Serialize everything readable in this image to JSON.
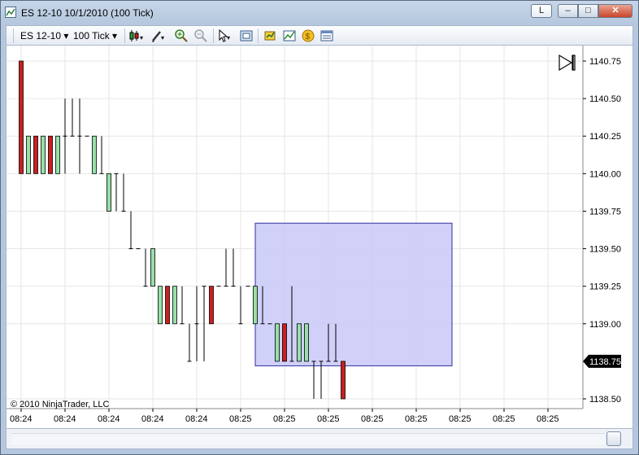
{
  "window": {
    "title": "ES 12-10  10/1/2010 (100 Tick)",
    "buttons": {
      "layout_label": "L",
      "minimize": "–",
      "maximize": "□",
      "close": "✕"
    }
  },
  "toolbar": {
    "instrument": "ES 12-10",
    "interval": "100 Tick",
    "icons": [
      "chart-style-icon",
      "drawing-tool-icon",
      "zoom-in-icon",
      "zoom-out-icon",
      "pointer-icon",
      "data-box-icon",
      "strategies-icon",
      "indicators-icon",
      "money-icon",
      "properties-icon"
    ]
  },
  "chart_data": {
    "type": "candlestick",
    "y_ticks": [
      "1140.75",
      "1140.50",
      "1140.25",
      "1140.00",
      "1139.75",
      "1139.50",
      "1139.25",
      "1139.00",
      "1138.50"
    ],
    "y_tick_values": [
      1140.75,
      1140.5,
      1140.25,
      1140.0,
      1139.75,
      1139.5,
      1139.25,
      1139.0,
      1138.5
    ],
    "current_price": "1138.75",
    "x_ticks": [
      "08:24",
      "08:24",
      "08:24",
      "08:24",
      "08:24",
      "08:25",
      "08:25",
      "08:25",
      "08:25",
      "08:25",
      "08:25",
      "08:25",
      "08:25"
    ],
    "bars": [
      {
        "o": 1140.0,
        "h": 1140.75,
        "l": 1140.0,
        "c": 1140.75,
        "dir": "up"
      },
      {
        "o": 1140.25,
        "h": 1140.25,
        "l": 1140.0,
        "c": 1140.0,
        "dir": "down"
      },
      {
        "o": 1140.0,
        "h": 1140.25,
        "l": 1140.0,
        "c": 1140.25,
        "dir": "up"
      },
      {
        "o": 1140.25,
        "h": 1140.25,
        "l": 1140.0,
        "c": 1140.0,
        "dir": "down"
      },
      {
        "o": 1140.0,
        "h": 1140.25,
        "l": 1140.0,
        "c": 1140.25,
        "dir": "up"
      },
      {
        "o": 1140.25,
        "h": 1140.25,
        "l": 1140.0,
        "c": 1140.0,
        "dir": "down"
      },
      {
        "o": 1140.25,
        "h": 1140.5,
        "l": 1140.0,
        "c": 1140.25,
        "dir": "flat"
      },
      {
        "o": 1140.25,
        "h": 1140.5,
        "l": 1140.25,
        "c": 1140.25,
        "dir": "flat"
      },
      {
        "o": 1140.25,
        "h": 1140.5,
        "l": 1140.0,
        "c": 1140.25,
        "dir": "flat"
      },
      {
        "o": 1140.25,
        "h": 1140.25,
        "l": 1140.25,
        "c": 1140.25,
        "dir": "flat"
      },
      {
        "o": 1140.25,
        "h": 1140.25,
        "l": 1140.0,
        "c": 1140.0,
        "dir": "down"
      },
      {
        "o": 1140.0,
        "h": 1140.25,
        "l": 1140.0,
        "c": 1140.0,
        "dir": "flat"
      },
      {
        "o": 1140.0,
        "h": 1140.0,
        "l": 1139.75,
        "c": 1139.75,
        "dir": "down"
      },
      {
        "o": 1140.0,
        "h": 1140.0,
        "l": 1139.75,
        "c": 1140.0,
        "dir": "flat"
      },
      {
        "o": 1140.0,
        "h": 1140.0,
        "l": 1139.75,
        "c": 1139.75,
        "dir": "flat"
      },
      {
        "o": 1139.75,
        "h": 1139.75,
        "l": 1139.5,
        "c": 1139.5,
        "dir": "flat"
      },
      {
        "o": 1139.5,
        "h": 1139.5,
        "l": 1139.5,
        "c": 1139.5,
        "dir": "flat"
      },
      {
        "o": 1139.5,
        "h": 1139.5,
        "l": 1139.25,
        "c": 1139.25,
        "dir": "flat"
      },
      {
        "o": 1139.5,
        "h": 1139.5,
        "l": 1139.25,
        "c": 1139.25,
        "dir": "down"
      },
      {
        "o": 1139.25,
        "h": 1139.25,
        "l": 1139.0,
        "c": 1139.0,
        "dir": "down"
      },
      {
        "o": 1139.0,
        "h": 1139.25,
        "l": 1139.0,
        "c": 1139.25,
        "dir": "up"
      },
      {
        "o": 1139.25,
        "h": 1139.25,
        "l": 1139.0,
        "c": 1139.0,
        "dir": "down"
      },
      {
        "o": 1139.25,
        "h": 1139.25,
        "l": 1139.0,
        "c": 1139.0,
        "dir": "flat"
      },
      {
        "o": 1139.0,
        "h": 1139.0,
        "l": 1138.75,
        "c": 1138.75,
        "dir": "flat"
      },
      {
        "o": 1139.0,
        "h": 1139.25,
        "l": 1138.75,
        "c": 1139.0,
        "dir": "flat"
      },
      {
        "o": 1139.0,
        "h": 1139.25,
        "l": 1138.75,
        "c": 1139.25,
        "dir": "flat"
      },
      {
        "o": 1139.0,
        "h": 1139.25,
        "l": 1139.0,
        "c": 1139.25,
        "dir": "up"
      },
      {
        "o": 1139.25,
        "h": 1139.25,
        "l": 1139.25,
        "c": 1139.25,
        "dir": "flat"
      },
      {
        "o": 1139.25,
        "h": 1139.5,
        "l": 1139.25,
        "c": 1139.25,
        "dir": "flat"
      },
      {
        "o": 1139.25,
        "h": 1139.5,
        "l": 1139.25,
        "c": 1139.25,
        "dir": "flat"
      },
      {
        "o": 1139.25,
        "h": 1139.25,
        "l": 1139.0,
        "c": 1139.0,
        "dir": "flat"
      },
      {
        "o": 1139.25,
        "h": 1139.25,
        "l": 1139.25,
        "c": 1139.25,
        "dir": "flat"
      },
      {
        "o": 1139.25,
        "h": 1139.25,
        "l": 1139.0,
        "c": 1139.0,
        "dir": "down"
      },
      {
        "o": 1139.0,
        "h": 1139.25,
        "l": 1139.0,
        "c": 1139.0,
        "dir": "flat"
      },
      {
        "o": 1139.0,
        "h": 1139.0,
        "l": 1139.0,
        "c": 1139.0,
        "dir": "flat"
      },
      {
        "o": 1139.0,
        "h": 1139.0,
        "l": 1138.75,
        "c": 1138.75,
        "dir": "down"
      },
      {
        "o": 1138.75,
        "h": 1139.0,
        "l": 1138.75,
        "c": 1139.0,
        "dir": "up"
      },
      {
        "o": 1139.0,
        "h": 1139.25,
        "l": 1138.75,
        "c": 1138.75,
        "dir": "flat"
      },
      {
        "o": 1139.0,
        "h": 1139.0,
        "l": 1138.75,
        "c": 1138.75,
        "dir": "down"
      },
      {
        "o": 1139.0,
        "h": 1139.0,
        "l": 1138.75,
        "c": 1138.75,
        "dir": "down"
      },
      {
        "o": 1138.75,
        "h": 1138.75,
        "l": 1138.5,
        "c": 1138.75,
        "dir": "flat"
      },
      {
        "o": 1138.75,
        "h": 1138.75,
        "l": 1138.5,
        "c": 1138.75,
        "dir": "flat"
      },
      {
        "o": 1138.75,
        "h": 1139.0,
        "l": 1138.75,
        "c": 1138.75,
        "dir": "flat"
      },
      {
        "o": 1138.75,
        "h": 1139.0,
        "l": 1138.75,
        "c": 1138.75,
        "dir": "flat"
      },
      {
        "o": 1138.5,
        "h": 1138.75,
        "l": 1138.5,
        "c": 1138.75,
        "dir": "up"
      }
    ],
    "selection_box": {
      "price_high": 1139.67,
      "price_low": 1138.72,
      "from_bar": 33,
      "to_bar": 59
    },
    "colors": {
      "up": "#cc1f1f",
      "down": "#98e0a8",
      "box_fill": "#c8c8f8",
      "box_stroke": "#3030a0"
    },
    "grid": true,
    "copyright": "© 2010 NinjaTrader, LLC"
  }
}
